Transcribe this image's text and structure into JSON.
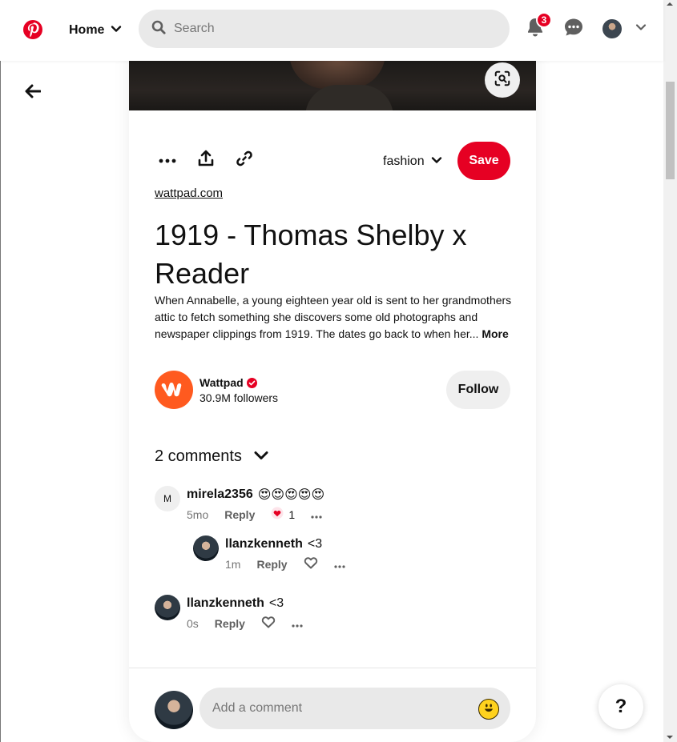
{
  "header": {
    "logo": "pinterest-logo",
    "home_label": "Home",
    "search_placeholder": "Search",
    "notifications_count": "3",
    "brand_color": "#e60023"
  },
  "pin": {
    "board_name": "fashion",
    "save_label": "Save",
    "source": "wattpad.com",
    "title": "1919 - Thomas Shelby x Reader",
    "description": "When Annabelle, a young eighteen year old is sent to her grandmothers attic to fetch something she discovers some old photographs and newspaper clippings from 1919. The dates go back to when her...",
    "more_label": "More"
  },
  "creator": {
    "name": "Wattpad",
    "followers": "30.9M followers",
    "follow_label": "Follow"
  },
  "comments": {
    "header": "2 comments",
    "items": [
      {
        "avatar_letter": "M",
        "user": "mirela2356",
        "text": "😍😍😍😍😍",
        "time": "5mo",
        "reply_label": "Reply",
        "reactions": "1",
        "replies": [
          {
            "user": "llanzkenneth",
            "text": "<3",
            "time": "1m",
            "reply_label": "Reply"
          }
        ]
      },
      {
        "user": "llanzkenneth",
        "text": "<3",
        "time": "0s",
        "reply_label": "Reply"
      }
    ]
  },
  "composer": {
    "placeholder": "Add a comment"
  },
  "help_label": "?"
}
